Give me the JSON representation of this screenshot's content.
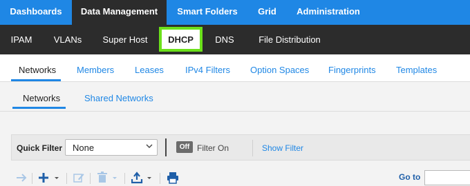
{
  "top_nav": {
    "items": [
      "Dashboards",
      "Data Management",
      "Smart Folders",
      "Grid",
      "Administration"
    ],
    "active": "Data Management"
  },
  "sub_nav": {
    "items": [
      "IPAM",
      "VLANs",
      "Super Host",
      "DHCP",
      "DNS",
      "File Distribution"
    ],
    "active": "DHCP"
  },
  "tabs_primary": {
    "items": [
      "Networks",
      "Members",
      "Leases",
      "IPv4 Filters",
      "Option Spaces",
      "Fingerprints",
      "Templates"
    ],
    "active": "Networks"
  },
  "tabs_secondary": {
    "items": [
      "Networks",
      "Shared Networks"
    ],
    "active": "Networks"
  },
  "filter": {
    "label": "Quick Filter",
    "selected": "None",
    "toggle": "Off",
    "toggle_label": "Filter On",
    "show_filter": "Show Filter"
  },
  "toolbar": {
    "icons": [
      "arrow-right-icon",
      "plus-icon",
      "edit-icon",
      "delete-icon",
      "upload-icon",
      "print-icon"
    ],
    "goto_label": "Go to"
  },
  "colors": {
    "top_nav_bg": "#1f87e5",
    "sub_nav_bg": "#2c2c2c",
    "active_highlight": "#6be01a",
    "link": "#1f87e5"
  }
}
